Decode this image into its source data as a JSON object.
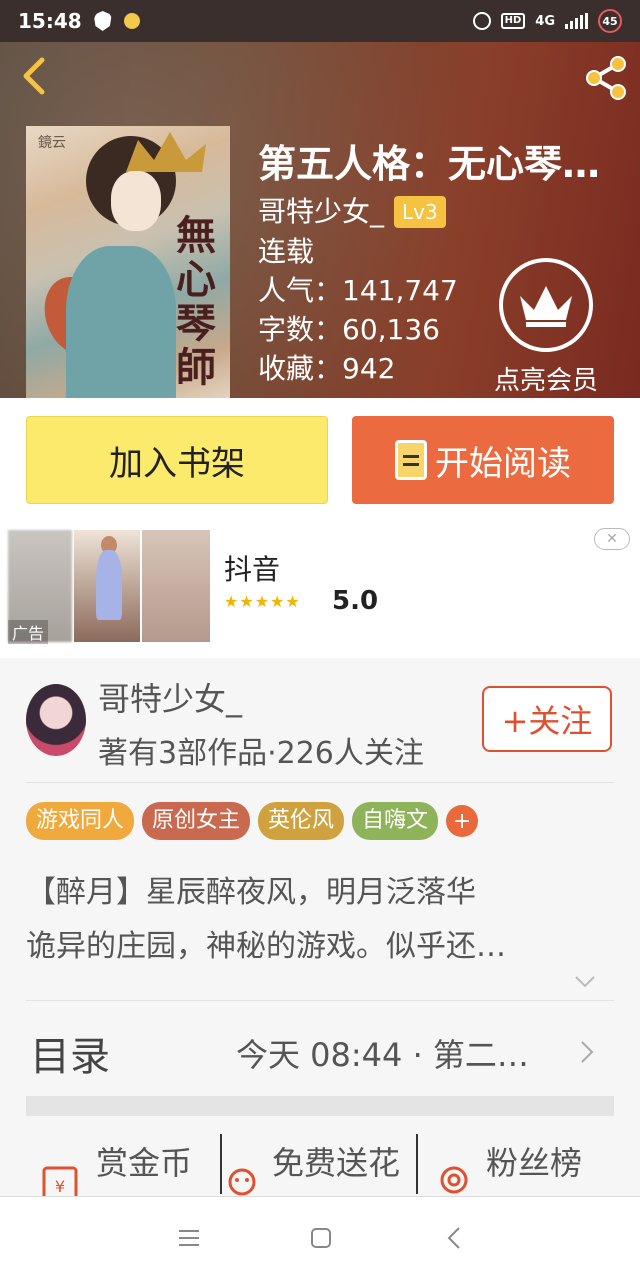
{
  "status_bar": {
    "time": "15:48",
    "battery": "45",
    "network": "4G"
  },
  "book": {
    "title": "第五人格：无心琴…",
    "author": "哥特少女_",
    "level": "Lv3",
    "status": "连载",
    "popularity": "人气：141,747",
    "words": "字数：60,136",
    "favorites": "收藏：942",
    "cover_brand": "鏡云",
    "cover_title": "無心琴師"
  },
  "vip": {
    "label": "点亮会员"
  },
  "actions": {
    "shelf_label": "加入书架",
    "read_label": "开始阅读"
  },
  "ad": {
    "tag": "广告",
    "name": "抖音",
    "stars": "★★★★★",
    "rating": "5.0",
    "close": "✕"
  },
  "author_section": {
    "name": "哥特少女_",
    "stats": "著有3部作品·226人关注",
    "follow_label": "+关注"
  },
  "tags": [
    {
      "label": "游戏同人",
      "color": "#f0a93c"
    },
    {
      "label": "原创女主",
      "color": "#c9694f"
    },
    {
      "label": "英伦风",
      "color": "#cfa23f"
    },
    {
      "label": "自嗨文",
      "color": "#8fb35a"
    }
  ],
  "tag_add": "+",
  "description": {
    "line1": "【醉月】星辰醉夜风，明月泛落华",
    "line2": "诡异的庄园，神秘的游戏。似乎还…"
  },
  "catalog": {
    "title": "目录",
    "latest": "今天 08:44 · 第二…"
  },
  "rewards": {
    "coins": "赏金币",
    "flowers": "免费送花",
    "fans": "粉丝榜"
  },
  "colors": {
    "accent": "#ec6a3f",
    "shelf": "#fbea6c",
    "follow": "#e0502f",
    "lv": "#f5c242"
  }
}
